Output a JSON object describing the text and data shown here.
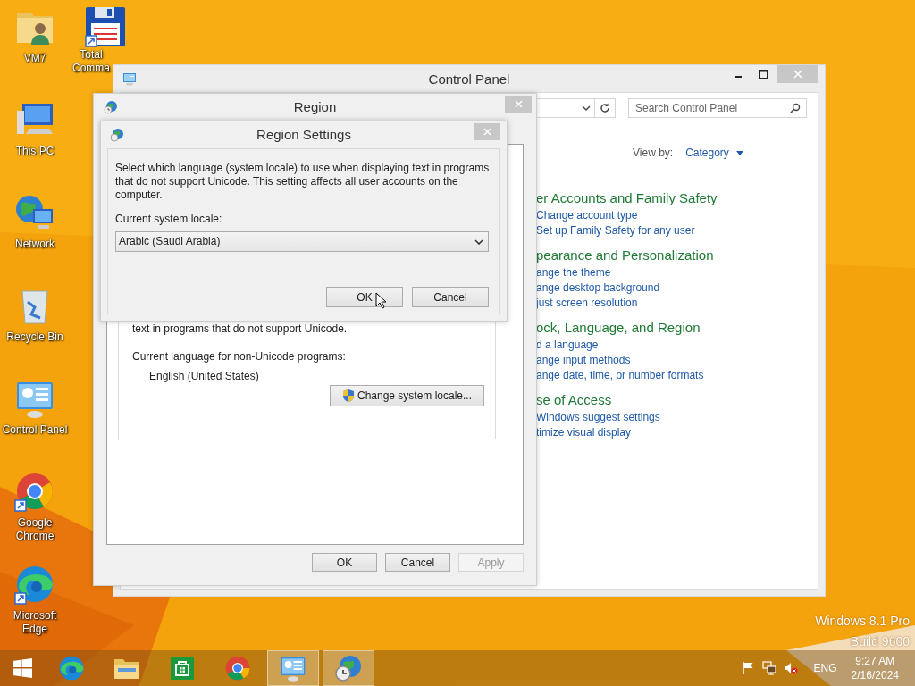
{
  "desktop_icons": [
    {
      "label": "VM7",
      "kind": "user-folder",
      "shortcut": false
    },
    {
      "label": "This PC",
      "kind": "pc",
      "shortcut": false
    },
    {
      "label": "Network",
      "kind": "network",
      "shortcut": false
    },
    {
      "label": "Recycle Bin",
      "kind": "recycle",
      "shortcut": false
    },
    {
      "label": "Control Panel",
      "kind": "control-panel",
      "shortcut": false
    },
    {
      "label": "Google Chrome",
      "kind": "chrome",
      "shortcut": true
    },
    {
      "label": "Microsoft Edge",
      "kind": "edge",
      "shortcut": true
    }
  ],
  "desktop_icons_column_2": [
    {
      "label": "Total Comma",
      "kind": "floppy",
      "shortcut": true
    }
  ],
  "control_panel": {
    "title": "Control Panel",
    "search": {
      "placeholder": "Search Control Panel"
    },
    "view_by_label": "View by:",
    "view_by_value": "Category",
    "categories": [
      {
        "heading": "er Accounts and Family Safety",
        "links": [
          "Change account type",
          "Set up Family Safety for any user"
        ]
      },
      {
        "heading": "pearance and Personalization",
        "links": [
          "ange the theme",
          "ange desktop background",
          "just screen resolution"
        ]
      },
      {
        "heading": "ock, Language, and Region",
        "links": [
          "d a language",
          "ange input methods",
          "ange date, time, or number formats"
        ]
      },
      {
        "heading": "se of Access",
        "links": [
          "Windows suggest settings",
          "timize visual display"
        ]
      }
    ]
  },
  "region": {
    "title": "Region",
    "text_partial": "text in programs that do not support Unicode.",
    "current_language_label": "Current language for non-Unicode programs:",
    "current_language": "English (United States)",
    "change_button": "Change system locale...",
    "buttons": [
      {
        "label": "OK",
        "disabled": false
      },
      {
        "label": "Cancel",
        "disabled": false
      },
      {
        "label": "Apply",
        "disabled": true
      }
    ]
  },
  "region_settings": {
    "title": "Region Settings",
    "description": "Select which language (system locale) to use when displaying text in programs that do not support Unicode. This setting affects all user accounts on the computer.",
    "locale_label": "Current system locale:",
    "locale": "Arabic (Saudi Arabia)",
    "buttons": [
      {
        "label": "OK",
        "disabled": false
      },
      {
        "label": "Cancel",
        "disabled": false
      }
    ]
  },
  "taskbar": {
    "apps": [
      {
        "kind": "start",
        "open": false
      },
      {
        "kind": "edge",
        "open": false
      },
      {
        "kind": "explorer",
        "open": false
      },
      {
        "kind": "store",
        "open": false
      },
      {
        "kind": "chrome",
        "open": false
      },
      {
        "kind": "control-panel",
        "open": true
      },
      {
        "kind": "region",
        "open": true
      }
    ],
    "volume_muted": true,
    "language": "ENG",
    "time": "9:27 AM",
    "date": "2/16/2024"
  },
  "watermark": {
    "edition": "Windows 8.1 Pro",
    "build": "Build 9600"
  }
}
